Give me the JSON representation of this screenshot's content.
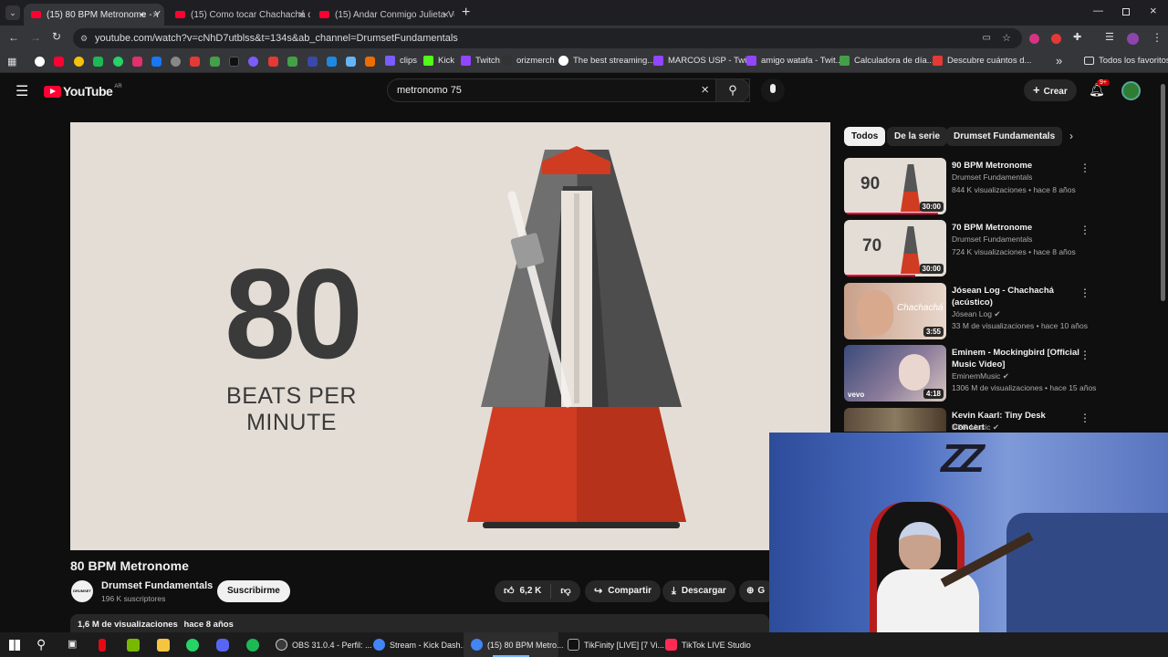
{
  "browser": {
    "tabs": [
      {
        "label": "(15) 80 BPM Metronome - Y"
      },
      {
        "label": "(15) Como tocar Chachachá de"
      },
      {
        "label": "(15) Andar Conmigo Julieta Ven"
      }
    ],
    "new_tab": "+",
    "url": "youtube.com/watch?v=cNhD7utblss&t=134s&ab_channel=DrumsetFundamentals",
    "bookmarks": [
      {
        "label": "clips",
        "color": "#7b5cff"
      },
      {
        "label": "Kick",
        "color": "#53fc18"
      },
      {
        "label": "Twitch",
        "color": "#9146ff"
      },
      {
        "label": "orizmerch",
        "color": "#333333"
      },
      {
        "label": "The best streaming...",
        "color": "#ffffff"
      },
      {
        "label": "MARCOS USP - Twit...",
        "color": "#9146ff"
      },
      {
        "label": "amigo watafa - Twit...",
        "color": "#9146ff"
      },
      {
        "label": "Calculadora de día...",
        "color": "#43a047"
      },
      {
        "label": "Descubre cuántos d...",
        "color": "#e53935"
      }
    ],
    "all_bookmarks": "Todos los favoritos",
    "bookmarks_more": "»"
  },
  "youtube": {
    "logo_text": "YouTube",
    "logo_country": "AR",
    "search_value": "metronomo 75",
    "create_label": "Crear",
    "notif_badge": "9+",
    "brand_color": "#ff0033"
  },
  "video": {
    "overlay_number": "80",
    "overlay_text": "BEATS PER MINUTE",
    "title": "80 BPM Metronome",
    "channel_name": "Drumset Fundamentals",
    "channel_avatar_text": "DRUMSET",
    "subscribers": "196 K suscriptores",
    "subscribe_label": "Suscribirme",
    "likes": "6,2 K",
    "share_label": "Compartir",
    "download_label": "Descargar",
    "clip_label": "G",
    "views": "1,6 M de visualizaciones",
    "age": "hace 8 años"
  },
  "chips": [
    "Todos",
    "De la serie",
    "Drumset Fundamentals"
  ],
  "recommendations": [
    {
      "title": "90 BPM Metronome",
      "channel": "Drumset Fundamentals",
      "meta": "844 K visualizaciones • hace 8 años",
      "duration": "30:00",
      "thumb_number": "90",
      "verified": false
    },
    {
      "title": "70 BPM Metronome",
      "channel": "Drumset Fundamentals",
      "meta": "724 K visualizaciones • hace 8 años",
      "duration": "30:00",
      "thumb_number": "70",
      "verified": false
    },
    {
      "title": "Jósean Log - Chachachá (acústico)",
      "channel": "Jósean Log",
      "meta": "33 M de visualizaciones • hace 10 años",
      "duration": "3:55",
      "thumb_text": "Chachachá",
      "verified": true
    },
    {
      "title": "Eminem - Mockingbird [Official Music Video]",
      "channel": "EminemMusic",
      "meta": "1306 M de visualizaciones • hace 15 años",
      "duration": "4:18",
      "thumb_text": "vevo",
      "verified": true
    },
    {
      "title": "Kevin Kaarl: Tiny Desk Concert",
      "channel": "NPR Music",
      "meta": "",
      "duration": "",
      "verified": true
    }
  ],
  "webcam": {
    "wall_text": "ZZ"
  },
  "taskbar": {
    "items": [
      {
        "label": "OBS 31.0.4 - Perfil: ...",
        "color": "#3a3a3a"
      },
      {
        "label": "Stream - Kick Dash...",
        "color": "#4285f4"
      },
      {
        "label": "(15) 80 BPM Metro...",
        "color": "#4285f4"
      },
      {
        "label": "TikFinity [LIVE] [7 Vi...",
        "color": "#111111"
      },
      {
        "label": "TikTok LIVE Studio",
        "color": "#fe2c55"
      }
    ]
  }
}
